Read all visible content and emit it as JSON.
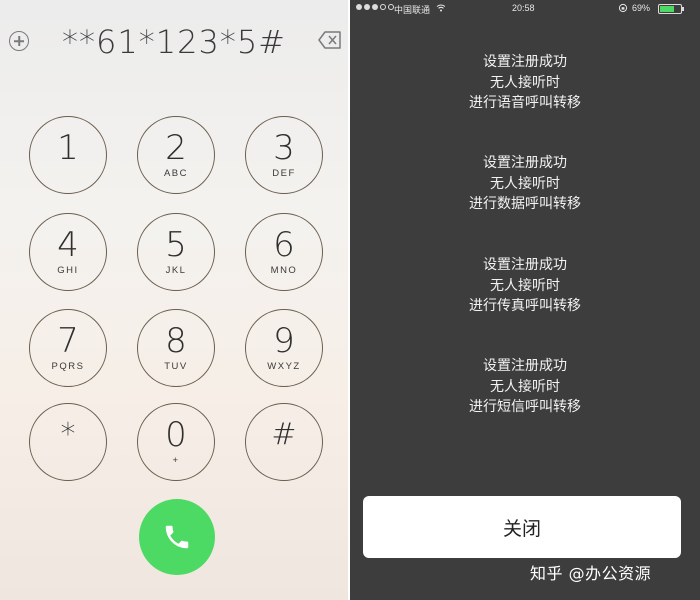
{
  "dialer": {
    "number": "**61*123*5#",
    "add_icon": "plus-circle-icon",
    "delete_icon": "delete-backspace-icon",
    "call_icon": "phone-icon",
    "call_color": "#4cd964",
    "keys": [
      {
        "digit": "1",
        "letters": ""
      },
      {
        "digit": "2",
        "letters": "ABC"
      },
      {
        "digit": "3",
        "letters": "DEF"
      },
      {
        "digit": "4",
        "letters": "GHI"
      },
      {
        "digit": "5",
        "letters": "JKL"
      },
      {
        "digit": "6",
        "letters": "MNO"
      },
      {
        "digit": "7",
        "letters": "PQRS"
      },
      {
        "digit": "8",
        "letters": "TUV"
      },
      {
        "digit": "9",
        "letters": "WXYZ"
      },
      {
        "digit": "*",
        "letters": ""
      },
      {
        "digit": "0",
        "letters": "+"
      },
      {
        "digit": "#",
        "letters": ""
      }
    ]
  },
  "status_bar": {
    "carrier": "中国联通",
    "time": "20:58",
    "battery": "69%",
    "battery_level": 0.69
  },
  "messages": [
    {
      "line1": "设置注册成功",
      "line2": "无人接听时",
      "line3": "进行语音呼叫转移"
    },
    {
      "line1": "设置注册成功",
      "line2": "无人接听时",
      "line3": "进行数据呼叫转移"
    },
    {
      "line1": "设置注册成功",
      "line2": "无人接听时",
      "line3": "进行传真呼叫转移"
    },
    {
      "line1": "设置注册成功",
      "line2": "无人接听时",
      "line3": "进行短信呼叫转移"
    }
  ],
  "close_label": "关闭",
  "watermark": "知乎 @办公资源"
}
